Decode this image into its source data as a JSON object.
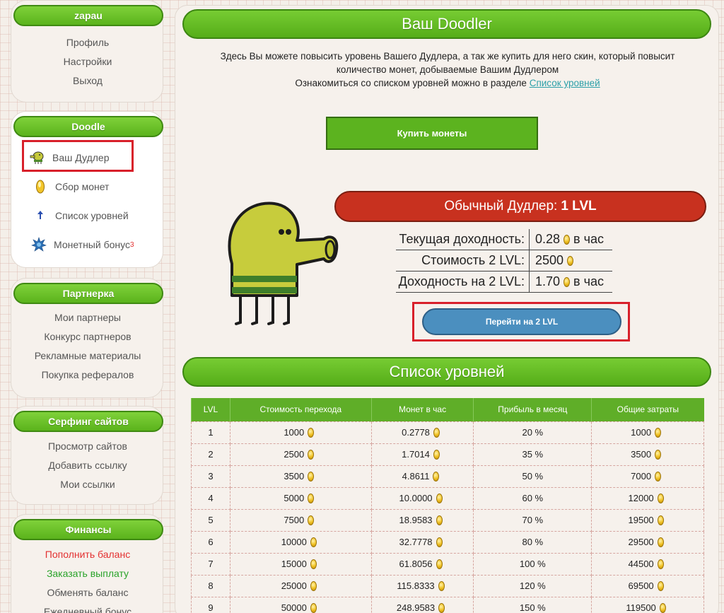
{
  "sidebar": {
    "user": {
      "title": "zapau",
      "links": [
        "Профиль",
        "Настройки",
        "Выход"
      ]
    },
    "doodle": {
      "title": "Doodle",
      "items": [
        {
          "label": "Ваш Дудлер",
          "icon": "doodler-icon"
        },
        {
          "label": "Сбор монет",
          "icon": "coin-icon"
        },
        {
          "label": "Список уровней",
          "icon": "arrow-up-icon"
        },
        {
          "label": "Монетный бонус",
          "icon": "bonus-star-icon",
          "badge": "3"
        }
      ]
    },
    "partner": {
      "title": "Партнерка",
      "links": [
        "Мои партнеры",
        "Конкурс партнеров",
        "Рекламные материалы",
        "Покупка рефералов"
      ]
    },
    "surfing": {
      "title": "Серфинг сайтов",
      "links": [
        "Просмотр сайтов",
        "Добавить ссылку",
        "Мои ссылки"
      ]
    },
    "finance": {
      "title": "Финансы",
      "links": [
        "Пополнить баланс",
        "Заказать выплату",
        "Обменять баланс",
        "Ежедневный бонус"
      ]
    }
  },
  "main": {
    "title": "Ваш Doodler",
    "intro_line1": "Здесь Вы можете повысить уровень Вашего Дудлера, а так же купить для него скин, который повысит",
    "intro_line2": "количество монет, добываемые Вашим Дудлером",
    "intro_line3": "Ознакомиться со списком уровней можно в разделе",
    "intro_link": "Список уровней",
    "buy_button": "Купить монеты",
    "level_title": "Обычный Дудлер:",
    "level_value": "1 LVL",
    "stats": [
      {
        "label": "Текущая доходность:",
        "value": "0.28",
        "suffix": "в час"
      },
      {
        "label": "Стоимость 2 LVL:",
        "value": "2500",
        "suffix": ""
      },
      {
        "label": "Доходность на 2 LVL:",
        "value": "1.70",
        "suffix": "в час"
      }
    ],
    "go_button": "Перейти на 2 LVL",
    "levels_title": "Список уровней",
    "table": {
      "headers": [
        "LVL",
        "Стоимость перехода",
        "Монет в час",
        "Прибыль в месяц",
        "Общие затраты"
      ],
      "rows": [
        [
          "1",
          "1000",
          "0.2778",
          "20 %",
          "1000"
        ],
        [
          "2",
          "2500",
          "1.7014",
          "35 %",
          "3500"
        ],
        [
          "3",
          "3500",
          "4.8611",
          "50 %",
          "7000"
        ],
        [
          "4",
          "5000",
          "10.0000",
          "60 %",
          "12000"
        ],
        [
          "5",
          "7500",
          "18.9583",
          "70 %",
          "19500"
        ],
        [
          "6",
          "10000",
          "32.7778",
          "80 %",
          "29500"
        ],
        [
          "7",
          "15000",
          "61.8056",
          "100 %",
          "44500"
        ],
        [
          "8",
          "25000",
          "115.8333",
          "120 %",
          "69500"
        ],
        [
          "9",
          "50000",
          "248.9583",
          "150 %",
          "119500"
        ]
      ]
    }
  },
  "colors": {
    "accent_green": "#5cb31f",
    "level_red": "#c8311f",
    "button_blue": "#4b8fbf",
    "highlight": "#d8202a"
  }
}
